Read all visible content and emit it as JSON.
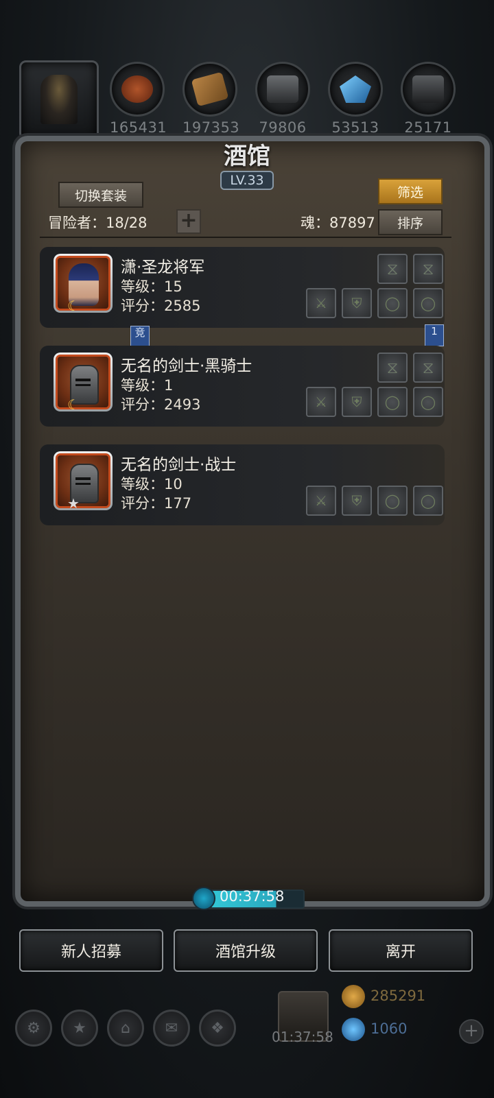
{
  "resources": [
    {
      "icon": "meat-icon",
      "value": "165431",
      "color": "#8a3a1e"
    },
    {
      "icon": "wood-icon",
      "value": "197353",
      "color": "#8a5b2a"
    },
    {
      "icon": "stone-icon",
      "value": "79806",
      "color": "#4a4c4f"
    },
    {
      "icon": "crystal-icon",
      "value": "53513",
      "color": "#2f7fb6"
    },
    {
      "icon": "iron-icon",
      "value": "25171",
      "color": "#3b3d40"
    }
  ],
  "panel": {
    "title": "酒馆",
    "level": "LV.33",
    "switch_outfit_label": "切换套装",
    "filter_label": "筛选",
    "sort_label": "排序",
    "adventurers_label": "冒险者：18/28",
    "souls_label": "魂：87897"
  },
  "heroes": [
    {
      "name": "潇·圣龙将军",
      "level": "等级：15",
      "score": "评分：2585",
      "badge": "moon-icon",
      "portrait": "general-portrait",
      "flag_left": "竞",
      "flag_right": "1"
    },
    {
      "name": "无名的剑士·黑骑士",
      "level": "等级：1",
      "score": "评分：2493",
      "badge": "moon-icon",
      "portrait": "knight-helmet"
    },
    {
      "name": "无名的剑士·战士",
      "level": "等级：10",
      "score": "评分：177",
      "badge": "star-icon",
      "portrait": "knight-helmet"
    }
  ],
  "timer": "00:37:58",
  "buttons": {
    "recruit": "新人招募",
    "upgrade": "酒馆升级",
    "leave": "离开"
  },
  "hud": {
    "gift_timer": "01:37:58",
    "gold": "285291",
    "gems": "1060"
  }
}
